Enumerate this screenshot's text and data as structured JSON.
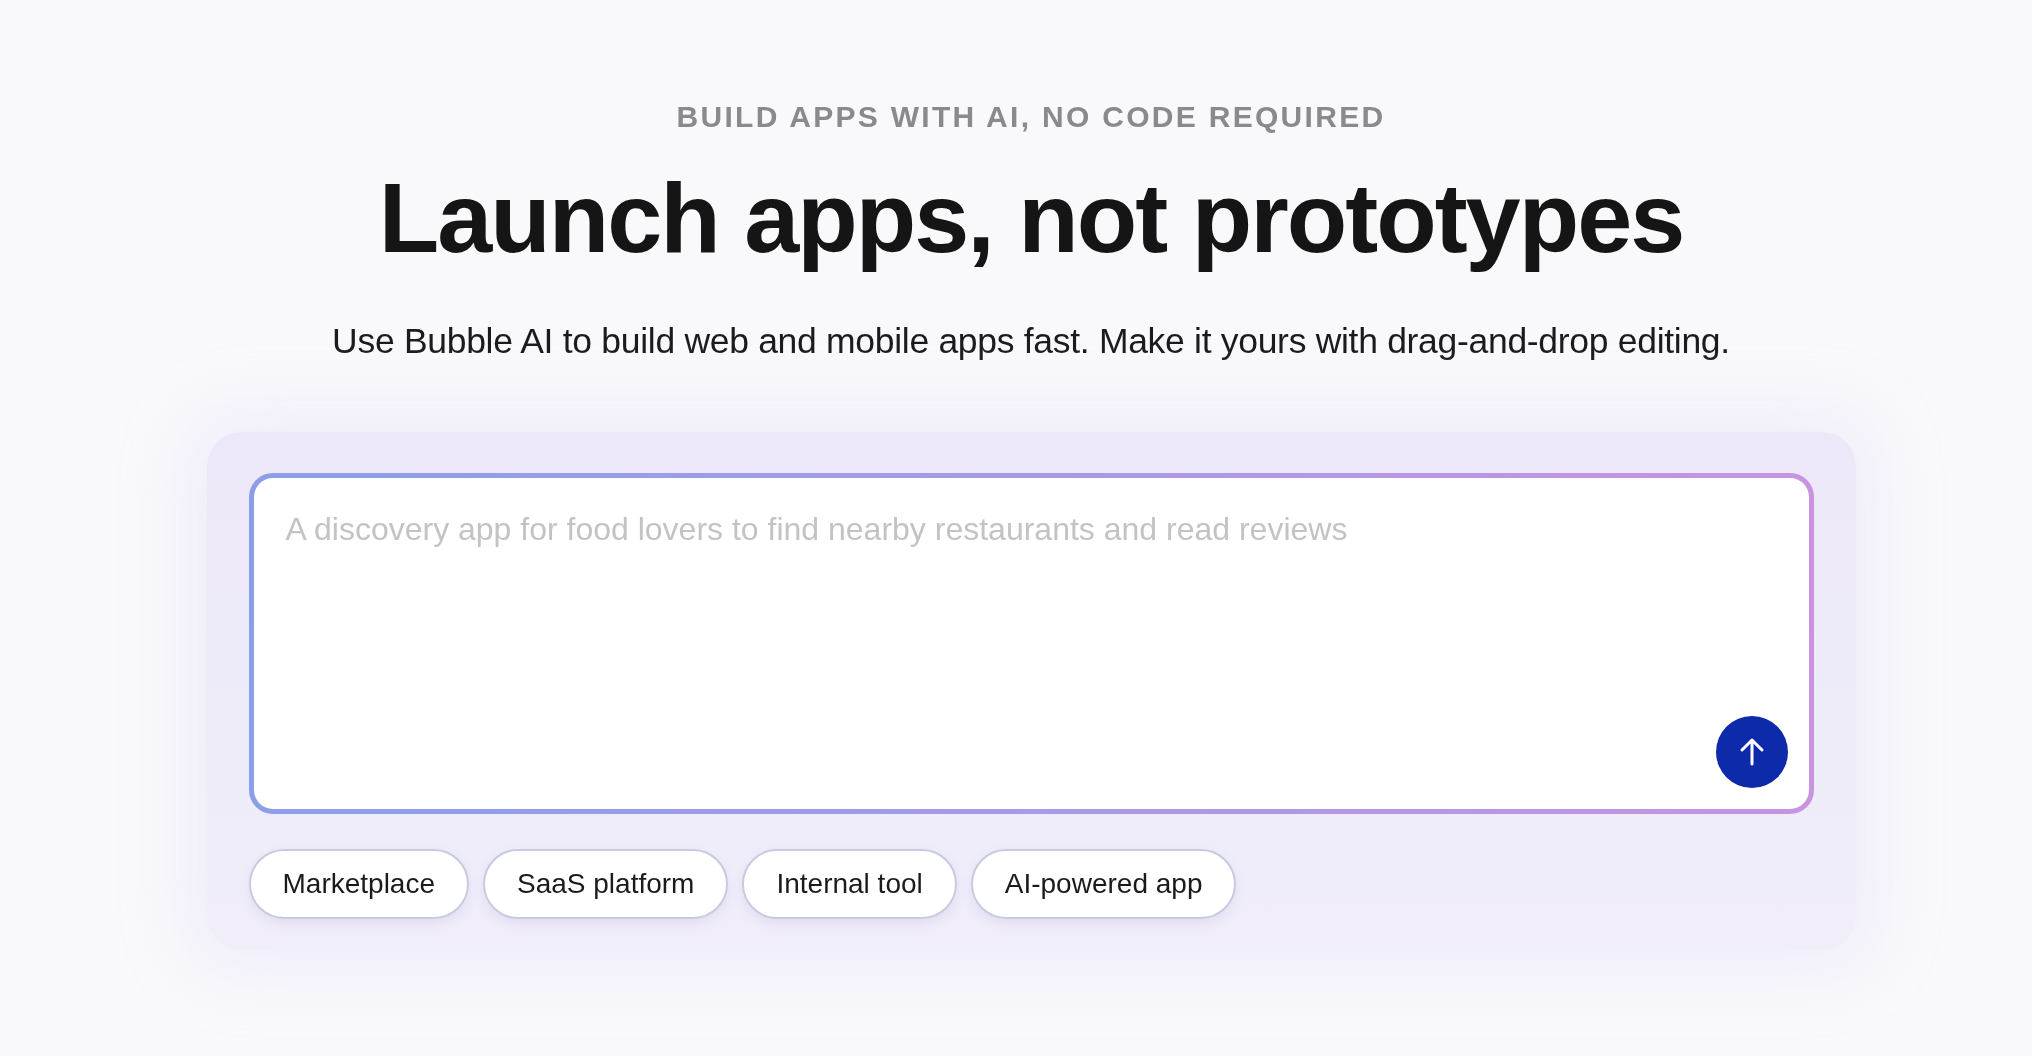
{
  "eyebrow": "BUILD APPS WITH AI, NO CODE REQUIRED",
  "headline": "Launch apps, not prototypes",
  "subtitle": "Use Bubble AI to build web and mobile apps fast. Make it yours with drag-and-drop editing.",
  "prompt": {
    "placeholder": "A discovery app for food lovers to find nearby restaurants and read reviews"
  },
  "suggestions": [
    "Marketplace",
    "SaaS platform",
    "Internal tool",
    "AI-powered app"
  ]
}
